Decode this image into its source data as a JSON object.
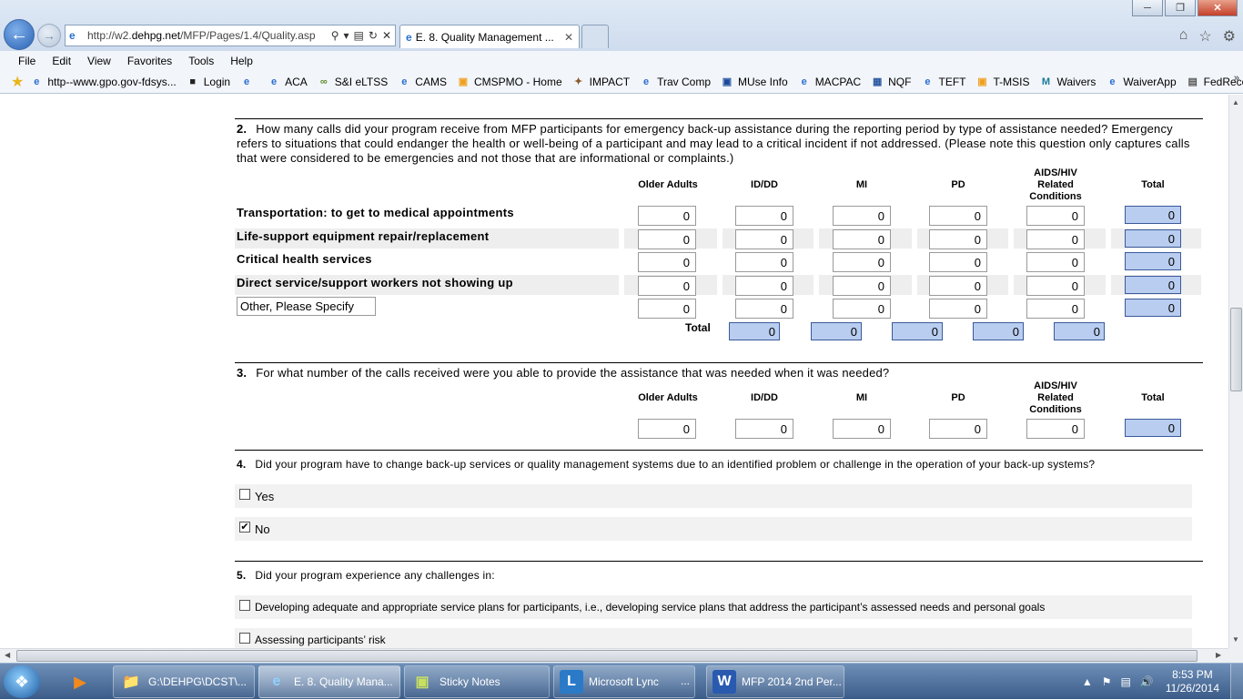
{
  "browser": {
    "address_url_prefix": "http://w2.",
    "address_url_domain": "dehpg.net",
    "address_url_path": "/MFP/Pages/1.4/Quality.asp",
    "tab_title": "E. 8. Quality Management ...",
    "menu": [
      "File",
      "Edit",
      "View",
      "Favorites",
      "Tools",
      "Help"
    ],
    "favorites": [
      {
        "label": "http--www.gpo.gov-fdsys...",
        "icon": "ie-page-icon"
      },
      {
        "label": "Login",
        "icon": "imdb-icon"
      },
      {
        "label": "",
        "icon": "ie-page-icon"
      },
      {
        "label": "ACA",
        "icon": "ie-page-icon"
      },
      {
        "label": "S&I eLTSS",
        "icon": "network-icon"
      },
      {
        "label": "CAMS",
        "icon": "ie-page-icon"
      },
      {
        "label": "CMSPMO - Home",
        "icon": "sharepoint-icon"
      },
      {
        "label": "IMPACT",
        "icon": "eagle-icon"
      },
      {
        "label": "Trav Comp",
        "icon": "ie-page-icon"
      },
      {
        "label": "MUse Info",
        "icon": "cdc-icon"
      },
      {
        "label": "MACPAC",
        "icon": "ie-page-icon"
      },
      {
        "label": "NQF",
        "icon": "grid-icon"
      },
      {
        "label": "TEFT",
        "icon": "ie-page-icon"
      },
      {
        "label": "T-MSIS",
        "icon": "sharepoint-icon"
      },
      {
        "label": "Waivers",
        "icon": "m-icon"
      },
      {
        "label": "WaiverApp",
        "icon": "ie-page-icon"
      },
      {
        "label": "FedRecords",
        "icon": "doc-icon"
      }
    ]
  },
  "q2": {
    "number": "2.",
    "text": "How many calls did your program receive from MFP participants for emergency back-up assistance during the reporting period by type of assistance needed? Emergency refers to situations that could endanger the health or well-being of a participant and may lead to a critical incident if not addressed. (Please note this question only captures calls that were considered to be emergencies and not those that are informational or complaints.)",
    "columns": [
      "Older Adults",
      "ID/DD",
      "MI",
      "PD",
      "AIDS/HIV Related Conditions",
      "Total"
    ],
    "rows": [
      {
        "label": "Transportation: to get to medical appointments",
        "values": [
          "0",
          "0",
          "0",
          "0",
          "0"
        ],
        "total": "0"
      },
      {
        "label": "Life-support equipment repair/replacement",
        "values": [
          "0",
          "0",
          "0",
          "0",
          "0"
        ],
        "total": "0"
      },
      {
        "label": "Critical health services",
        "values": [
          "0",
          "0",
          "0",
          "0",
          "0"
        ],
        "total": "0"
      },
      {
        "label": "Direct service/support workers not showing up",
        "values": [
          "0",
          "0",
          "0",
          "0",
          "0"
        ],
        "total": "0"
      },
      {
        "label": "Other, Please Specify",
        "values": [
          "0",
          "0",
          "0",
          "0",
          "0"
        ],
        "total": "0"
      }
    ],
    "total_label": "Total",
    "column_totals": [
      "0",
      "0",
      "0",
      "0",
      "0"
    ]
  },
  "q3": {
    "number": "3.",
    "text": "For what number of the calls received were you able to provide the assistance that was needed when it was needed?",
    "columns": [
      "Older Adults",
      "ID/DD",
      "MI",
      "PD",
      "AIDS/HIV Related Conditions",
      "Total"
    ],
    "values": [
      "0",
      "0",
      "0",
      "0",
      "0"
    ],
    "total": "0"
  },
  "q4": {
    "number": "4.",
    "text": "Did your program have to change back-up services or quality management systems due to an identified problem or challenge in the operation of your back-up systems?",
    "options": [
      {
        "label": "Yes",
        "checked": false
      },
      {
        "label": "No",
        "checked": true
      }
    ]
  },
  "q5": {
    "number": "5.",
    "text": "Did your program experience any challenges in:",
    "options": [
      {
        "label": "Developing adequate and appropriate service plans for participants, i.e., developing service plans that address the participant’s assessed needs and personal goals",
        "checked": false
      },
      {
        "label": "Assessing participants’ risk",
        "checked": false
      }
    ]
  },
  "taskbar": {
    "items": [
      {
        "label": "G:\\DEHPG\\DCST\\...",
        "icon": "folder-icon"
      },
      {
        "label": "E. 8. Quality Mana...",
        "icon": "ie-icon"
      },
      {
        "label": "Sticky Notes",
        "icon": "sticky-notes-icon"
      },
      {
        "label": "Microsoft Lync",
        "icon": "lync-icon"
      },
      {
        "label": "...",
        "icon": ""
      },
      {
        "label": "MFP 2014 2nd Per...",
        "icon": "word-icon"
      }
    ],
    "time": "8:53 PM",
    "date": "11/26/2014"
  }
}
